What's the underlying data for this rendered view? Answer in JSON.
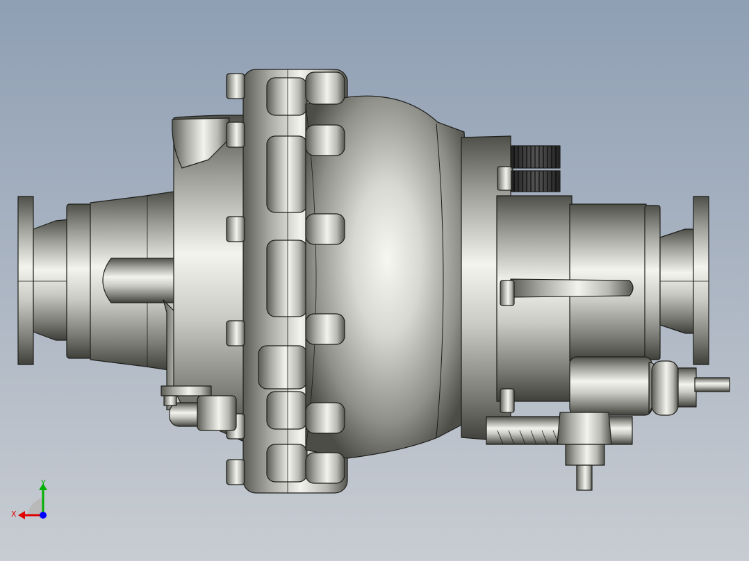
{
  "viewport": {
    "background_top": "#8f9fb4",
    "background_bottom": "#c8ccd2",
    "model": {
      "name": "gearbox-assembly",
      "parts": [
        "left-flange",
        "left-housing",
        "oil-boss",
        "bolt-ring-left",
        "main-shell",
        "bolt-ring-right",
        "right-housing",
        "right-flange",
        "threaded-studs",
        "bellows-boot",
        "control-rod",
        "drain-fitting"
      ],
      "colors": {
        "metal_light": "#f3f3ee",
        "metal_mid": "#a9aaa2",
        "metal_dark": "#4a4a44",
        "edge": "#1e1e1a"
      }
    },
    "triad": {
      "x_label": "X",
      "y_label": "Y",
      "colors": {
        "x": "#e00000",
        "y": "#00b000",
        "z": "#0000ff",
        "plane": "#b9b9b9"
      }
    }
  }
}
